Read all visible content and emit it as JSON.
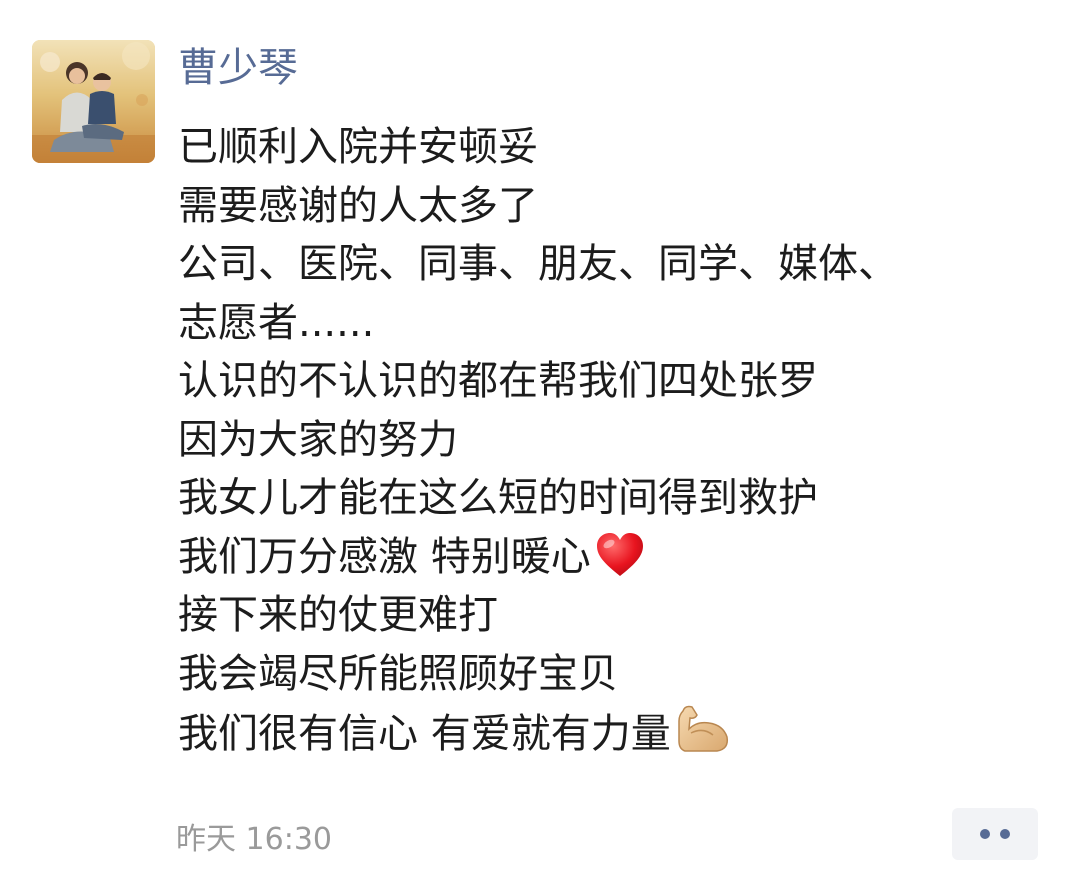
{
  "post": {
    "author": "曹少琴",
    "lines": [
      "已顺利入院并安顿妥",
      "需要感谢的人太多了",
      "公司、医院、同事、朋友、同学、媒体、",
      "志愿者......",
      "认识的不认识的都在帮我们四处张罗",
      "因为大家的努力",
      "我女儿才能在这么短的时间得到救护",
      "我们万分感激 特别暖心",
      "接下来的仗更难打",
      "我会竭尽所能照顾好宝贝",
      "我们很有信心 有爱就有力量"
    ],
    "line8_emoji": "red-heart-icon",
    "line11_emoji": "flexed-biceps-icon",
    "timestamp": "昨天 16:30"
  },
  "colors": {
    "author": "#576b95",
    "text": "#1c1c1c",
    "timestamp": "#9a9a9a",
    "more_button_bg": "#f2f3f6",
    "more_button_dots": "#576b95"
  }
}
